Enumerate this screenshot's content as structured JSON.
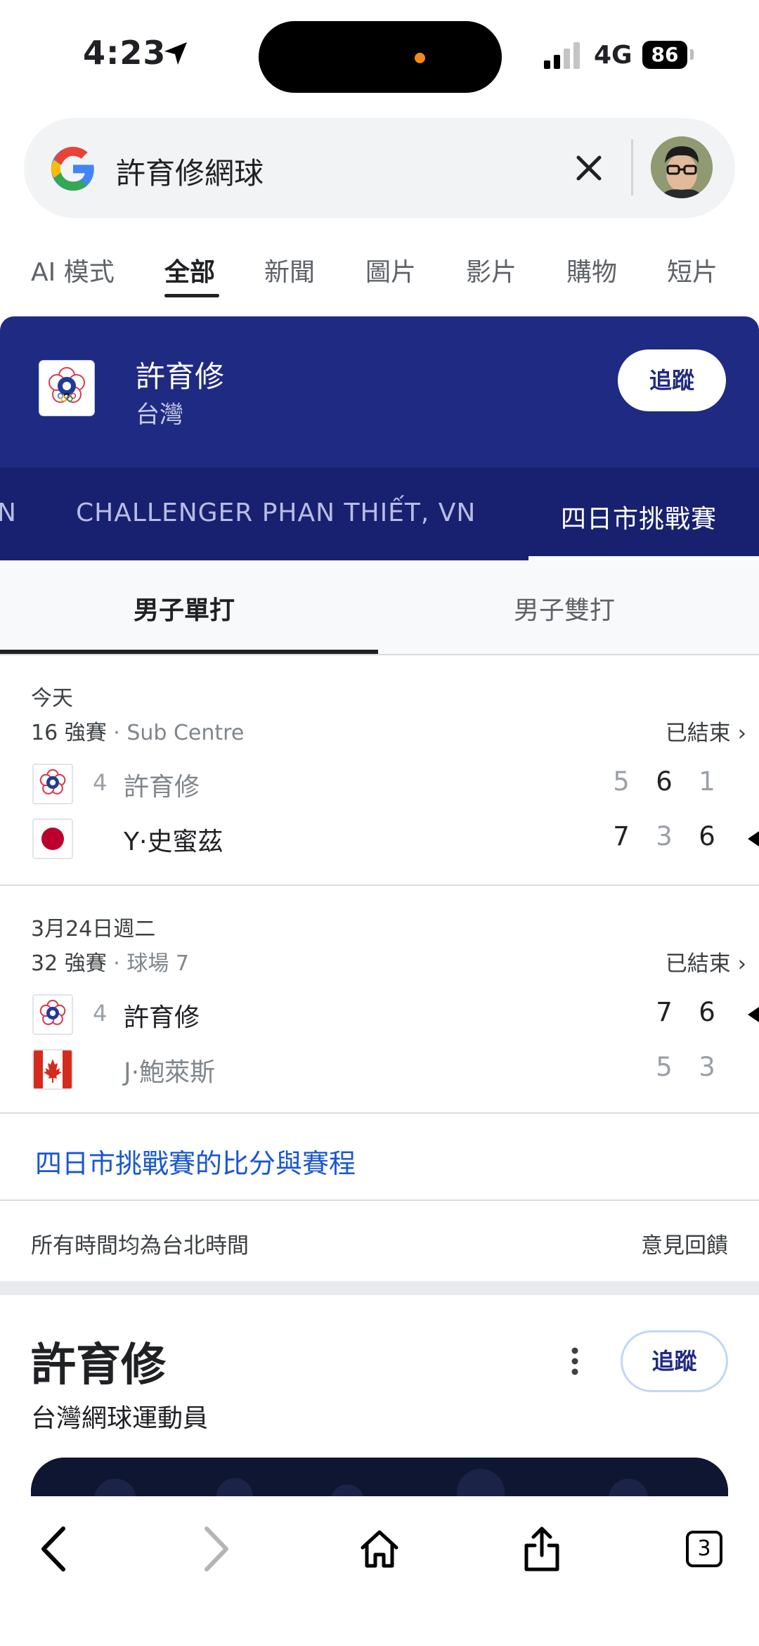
{
  "status_bar": {
    "time": "4:23",
    "network": "4G",
    "battery": "86"
  },
  "search": {
    "query": "許育修網球"
  },
  "tabs": [
    {
      "label": "AI 模式",
      "active": false
    },
    {
      "label": "全部",
      "active": true
    },
    {
      "label": "新聞",
      "active": false
    },
    {
      "label": "圖片",
      "active": false
    },
    {
      "label": "影片",
      "active": false
    },
    {
      "label": "購物",
      "active": false
    },
    {
      "label": "短片",
      "active": false
    }
  ],
  "header": {
    "player_name": "許育修",
    "country": "台灣",
    "follow_label": "追蹤",
    "tournaments": [
      {
        "label": "N",
        "active": false
      },
      {
        "label": "CHALLENGER PHAN THIẾT, VN",
        "active": false
      },
      {
        "label": "四日市挑戰賽",
        "active": true
      }
    ]
  },
  "subtabs": [
    {
      "label": "男子單打",
      "active": true
    },
    {
      "label": "男子雙打",
      "active": false
    }
  ],
  "matches": [
    {
      "date": "今天",
      "round": "16 強賽",
      "court": "· Sub Centre",
      "status": "已結束",
      "teams": [
        {
          "flag": "chinese-taipei",
          "seed": "4",
          "name": "許育修",
          "sets": [
            "5",
            "6",
            "1"
          ],
          "lost_sets": [
            true,
            false,
            true
          ],
          "winner": false
        },
        {
          "flag": "japan",
          "seed": "",
          "name": "Y·史蜜茲",
          "sets": [
            "7",
            "3",
            "6"
          ],
          "lost_sets": [
            false,
            true,
            false
          ],
          "winner": true
        }
      ]
    },
    {
      "date": "3月24日週二",
      "round": "32 強賽",
      "court": "· 球場 7",
      "status": "已結束",
      "teams": [
        {
          "flag": "chinese-taipei",
          "seed": "4",
          "name": "許育修",
          "sets": [
            "7",
            "6"
          ],
          "lost_sets": [
            false,
            false
          ],
          "winner": true
        },
        {
          "flag": "canada",
          "seed": "",
          "name": "J·鮑萊斯",
          "sets": [
            "5",
            "3"
          ],
          "lost_sets": [
            true,
            true
          ],
          "winner": false
        }
      ]
    }
  ],
  "more_link": "四日市挑戰賽的比分與賽程",
  "footer": {
    "timezone_note": "所有時間均為台北時間",
    "feedback": "意見回饋"
  },
  "knowledge_panel": {
    "title": "許育修",
    "subtitle": "台灣網球運動員",
    "follow_label": "追蹤"
  },
  "bottom_nav": {
    "tab_count": "3"
  },
  "colors": {
    "header_bg": "#1f2a83",
    "tournament_bar_bg": "#18216f",
    "link_blue": "#1a57d0",
    "orange_indicator": "#f28a1a"
  }
}
